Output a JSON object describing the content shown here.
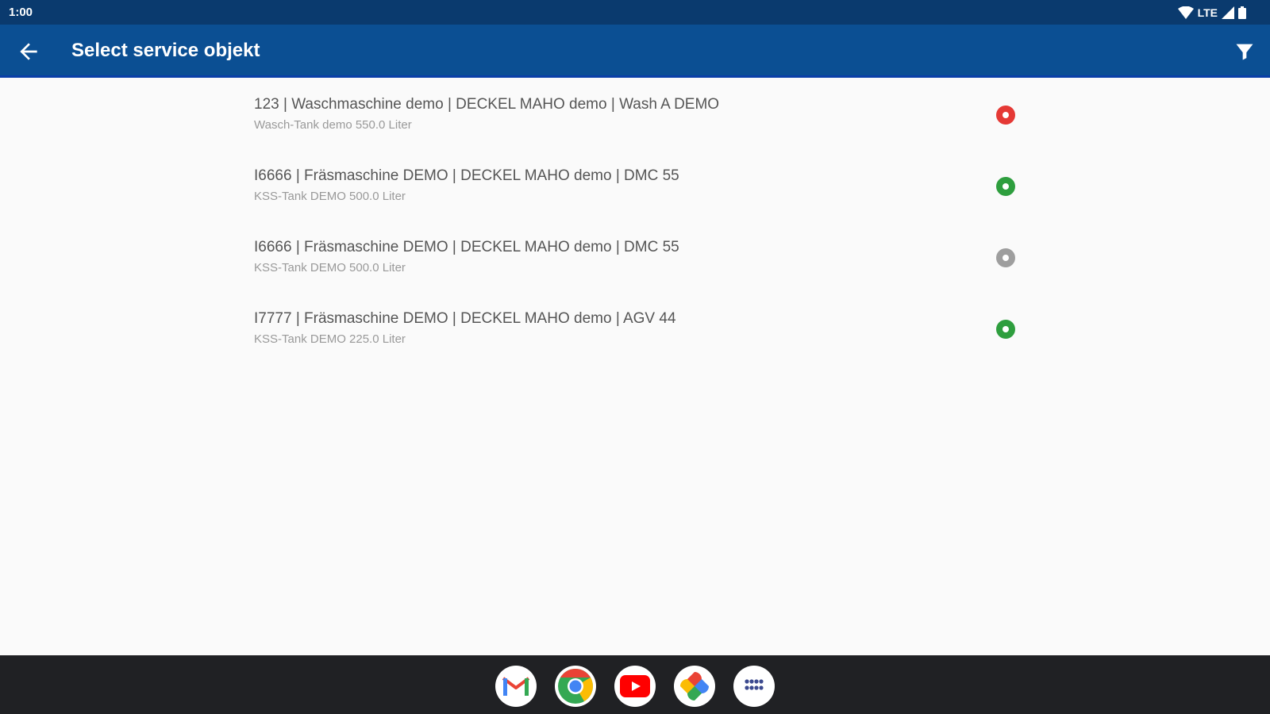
{
  "status_bar": {
    "time": "1:00",
    "network": "LTE",
    "icons": [
      "wifi-icon",
      "cell-signal-icon",
      "battery-icon"
    ]
  },
  "app_bar": {
    "title": "Select service objekt",
    "back_icon": "arrow-back-icon",
    "filter_icon": "filter-icon",
    "background": "#0b4f93"
  },
  "service_objects": [
    {
      "title": "123 | Waschmaschine demo | DECKEL MAHO demo | Wash A DEMO",
      "subtitle": "Wasch-Tank demo 550.0 Liter",
      "status": "error",
      "status_color": "#e53935"
    },
    {
      "title": "I6666 | Fräsmaschine DEMO | DECKEL MAHO demo | DMC 55",
      "subtitle": "KSS-Tank DEMO 500.0 Liter",
      "status": "ok",
      "status_color": "#2e9e3e"
    },
    {
      "title": "I6666 | Fräsmaschine DEMO | DECKEL MAHO demo | DMC 55",
      "subtitle": "KSS-Tank DEMO 500.0 Liter",
      "status": "inactive",
      "status_color": "#9e9e9e"
    },
    {
      "title": "I7777 | Fräsmaschine DEMO | DECKEL MAHO demo | AGV 44",
      "subtitle": "KSS-Tank DEMO 225.0 Liter",
      "status": "ok",
      "status_color": "#2e9e3e"
    }
  ],
  "dock": {
    "apps": [
      "gmail-icon",
      "chrome-icon",
      "youtube-icon",
      "photos-icon",
      "app-drawer-icon"
    ]
  }
}
